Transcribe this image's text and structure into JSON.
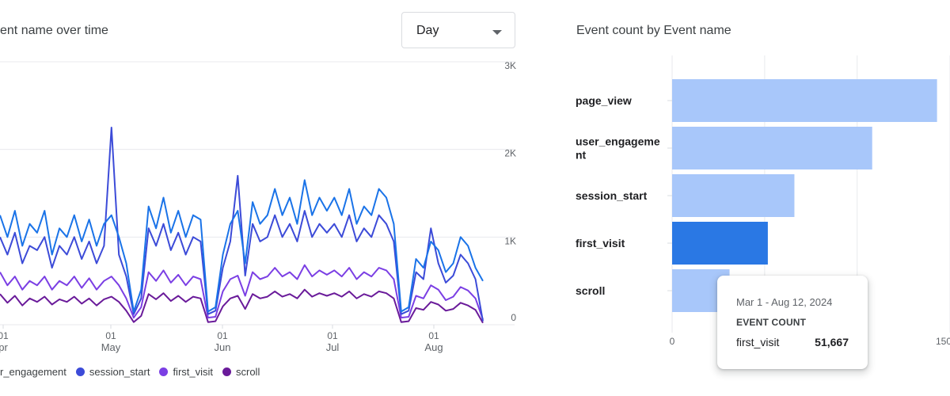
{
  "line_card": {
    "title": "ent name over time",
    "select": {
      "value": "Day"
    },
    "legend": [
      {
        "label": "r_engagement",
        "color": "#1a73e8"
      },
      {
        "label": "session_start",
        "color": "#3c4bd8"
      },
      {
        "label": "first_visit",
        "color": "#7b3fe4"
      },
      {
        "label": "scroll",
        "color": "#6a1b9a"
      }
    ]
  },
  "bar_card": {
    "title": "Event count by Event name",
    "tooltip": {
      "date_range": "Mar 1 - Aug 12, 2024",
      "metric": "EVENT COUNT",
      "event": "first_visit",
      "value": "51,667"
    }
  },
  "chart_data": [
    {
      "type": "line",
      "y_ticks": [
        "3K",
        "2K",
        "1K",
        "0"
      ],
      "ylim": [
        0,
        3000
      ],
      "grid": true,
      "x_tick_labels": [
        {
          "day": "01",
          "month": "pr"
        },
        {
          "day": "01",
          "month": "May"
        },
        {
          "day": "01",
          "month": "Jun"
        },
        {
          "day": "01",
          "month": "Jul"
        },
        {
          "day": "01",
          "month": "Aug"
        }
      ],
      "series": [
        {
          "name": "user_engagement",
          "color": "#1a73e8",
          "values": [
            1250,
            1000,
            1300,
            900,
            1150,
            1050,
            1300,
            800,
            1100,
            1000,
            1250,
            950,
            1200,
            900,
            1150,
            1250,
            1000,
            700,
            150,
            400,
            1350,
            1100,
            1450,
            1050,
            1300,
            1000,
            1250,
            1200,
            150,
            200,
            800,
            1150,
            1300,
            700,
            1400,
            1150,
            1250,
            1550,
            1250,
            1450,
            1150,
            1650,
            1250,
            1450,
            1300,
            1450,
            1250,
            1550,
            1150,
            1350,
            1250,
            1550,
            1450,
            1150,
            150,
            200,
            750,
            650,
            950,
            850,
            600,
            700,
            1000,
            900,
            650,
            500
          ]
        },
        {
          "name": "session_start",
          "color": "#3c4bd8",
          "values": [
            1000,
            800,
            1050,
            700,
            900,
            850,
            1000,
            650,
            900,
            800,
            1000,
            750,
            950,
            700,
            900,
            2250,
            800,
            550,
            120,
            300,
            1100,
            900,
            1150,
            850,
            1050,
            800,
            1000,
            950,
            120,
            160,
            650,
            950,
            1700,
            560,
            1150,
            950,
            1000,
            1250,
            1000,
            1150,
            950,
            1300,
            1000,
            1150,
            1050,
            1150,
            1000,
            1250,
            950,
            1100,
            1000,
            1250,
            1150,
            950,
            120,
            160,
            600,
            520,
            1100,
            700,
            480,
            560,
            800,
            700,
            520,
            40
          ]
        },
        {
          "name": "first_visit",
          "color": "#7b3fe4",
          "values": [
            600,
            450,
            550,
            400,
            500,
            450,
            550,
            400,
            500,
            450,
            550,
            420,
            530,
            400,
            500,
            550,
            450,
            300,
            80,
            200,
            600,
            500,
            620,
            480,
            570,
            450,
            550,
            520,
            80,
            90,
            380,
            520,
            560,
            330,
            600,
            520,
            550,
            650,
            550,
            600,
            520,
            680,
            550,
            620,
            570,
            620,
            550,
            650,
            520,
            600,
            550,
            650,
            620,
            520,
            80,
            90,
            330,
            300,
            450,
            400,
            280,
            320,
            430,
            390,
            300,
            60
          ]
        },
        {
          "name": "scroll",
          "color": "#6a1b9a",
          "values": [
            350,
            250,
            330,
            220,
            300,
            260,
            320,
            230,
            290,
            260,
            320,
            240,
            300,
            220,
            290,
            320,
            260,
            160,
            30,
            100,
            350,
            290,
            360,
            270,
            330,
            260,
            320,
            300,
            30,
            40,
            210,
            300,
            330,
            180,
            350,
            300,
            320,
            380,
            320,
            350,
            300,
            400,
            320,
            360,
            330,
            360,
            320,
            380,
            300,
            350,
            320,
            380,
            360,
            300,
            30,
            40,
            190,
            170,
            260,
            230,
            160,
            180,
            250,
            220,
            170,
            20
          ]
        }
      ]
    },
    {
      "type": "bar",
      "orientation": "horizontal",
      "categories": [
        "page_view",
        "user_engageme\nnt",
        "session_start",
        "first_visit",
        "scroll"
      ],
      "values": [
        143000,
        108000,
        66000,
        51667,
        31000
      ],
      "xlim": [
        0,
        150000
      ],
      "x_ticks": [
        "0",
        "150"
      ],
      "highlighted": "first_visit",
      "bar_color": "#a8c7fa",
      "highlight_color": "#2a78e4"
    }
  ]
}
